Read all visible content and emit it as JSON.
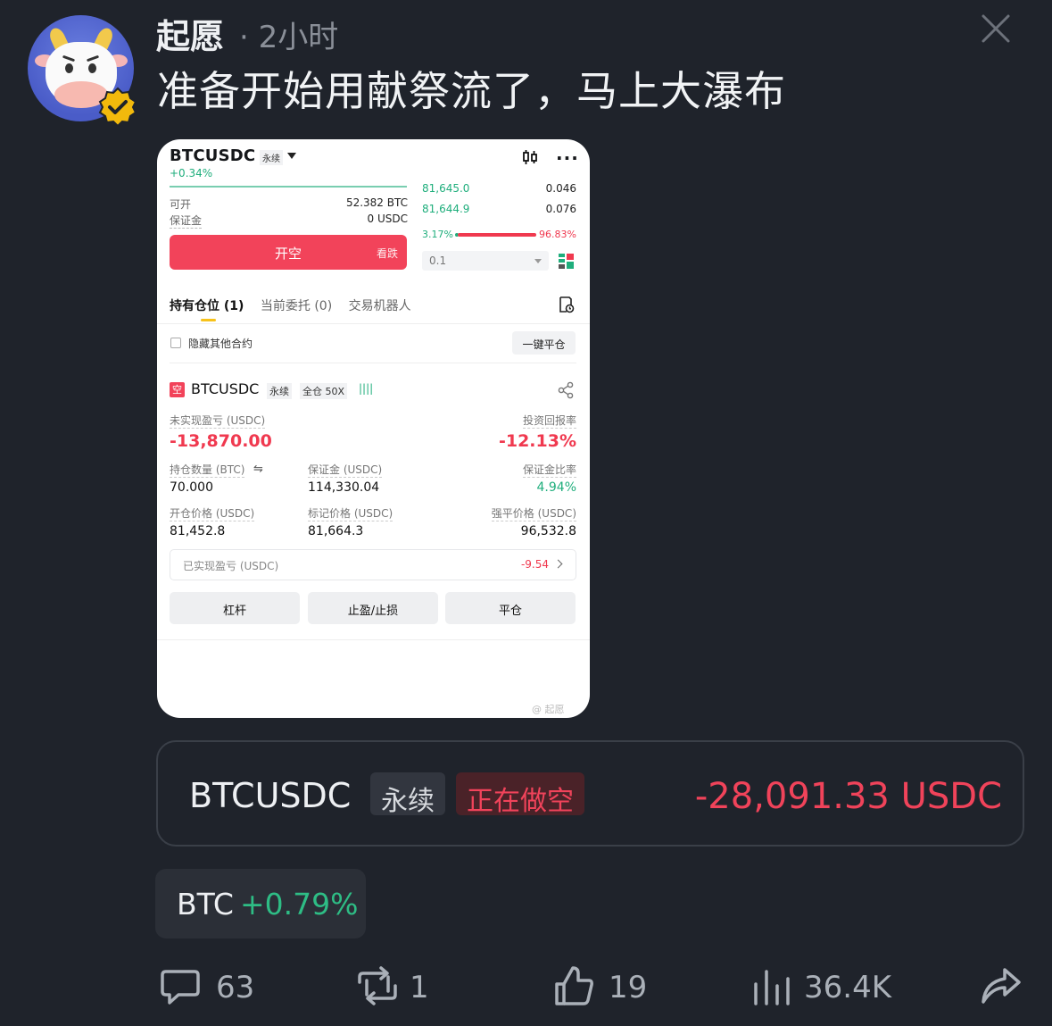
{
  "post": {
    "username": "起愿",
    "time": "· 2小时",
    "text": "准备开始用献祭流了，马上大瀑布"
  },
  "screenshot": {
    "symbol": "BTCUSDC",
    "symbol_tag": "永续",
    "change": "+0.34%",
    "available_label": "可开",
    "available_value": "52.382 BTC",
    "margin_label": "保证金",
    "margin_value": "0 USDC",
    "orderbook": [
      {
        "price": "81,645.0",
        "qty": "0.046"
      },
      {
        "price": "81,644.9",
        "qty": "0.076"
      }
    ],
    "ratio_left": "3.17%",
    "ratio_right": "96.83%",
    "buy_sell_ratio": 0.0317,
    "qty_value": "0.1",
    "short_button": "开空",
    "short_button_sub": "看跌",
    "tabs": [
      "持有仓位 (1)",
      "当前委托 (0)",
      "交易机器人"
    ],
    "hide_other": "隐藏其他合约",
    "close_all": "一键平仓",
    "position": {
      "badge": "空",
      "symbol": "BTCUSDC",
      "perp": "永续",
      "leverage": "全仓 50X",
      "bars": "||||",
      "unrealized_label": "未实现盈亏 (USDC)",
      "unrealized_value": "-13,870.00",
      "roe_label": "投资回报率",
      "roe_value": "-12.13%",
      "size_label": "持仓数量 (BTC)",
      "size_value": "70.000",
      "margin_label": "保证金 (USDC)",
      "margin_value": "114,330.04",
      "margin_ratio_label": "保证金比率",
      "margin_ratio_value": "4.94%",
      "entry_label": "开仓价格 (USDC)",
      "entry_value": "81,452.8",
      "mark_label": "标记价格 (USDC)",
      "mark_value": "81,664.3",
      "liq_label": "强平价格 (USDC)",
      "liq_value": "96,532.8",
      "realized_label": "已实现盈亏 (USDC)",
      "realized_value": "-9.54"
    },
    "buttons": [
      "杠杆",
      "止盈/止损",
      "平仓"
    ],
    "watermark": "@ 起愿"
  },
  "summary_card": {
    "symbol": "BTCUSDC",
    "perp": "永续",
    "status": "正在做空",
    "pnl": "-28,091.33 USDC"
  },
  "ticker": {
    "name": "BTC",
    "change": "+0.79%"
  },
  "actions": {
    "comments": "63",
    "reposts": "1",
    "likes": "19",
    "views": "36.4K"
  },
  "icons": [
    "close-icon",
    "verified-badge-icon",
    "candlestick-icon",
    "more-icon",
    "layout-grid-icon",
    "order-history-icon",
    "share-icon",
    "comment-icon",
    "repost-icon",
    "like-icon",
    "views-icon",
    "forward-icon"
  ],
  "colors": {
    "background": "#1f232b",
    "loss_red": "#f0435a",
    "gain_green": "#2ebd85",
    "accent_yellow": "#f7c21a"
  }
}
